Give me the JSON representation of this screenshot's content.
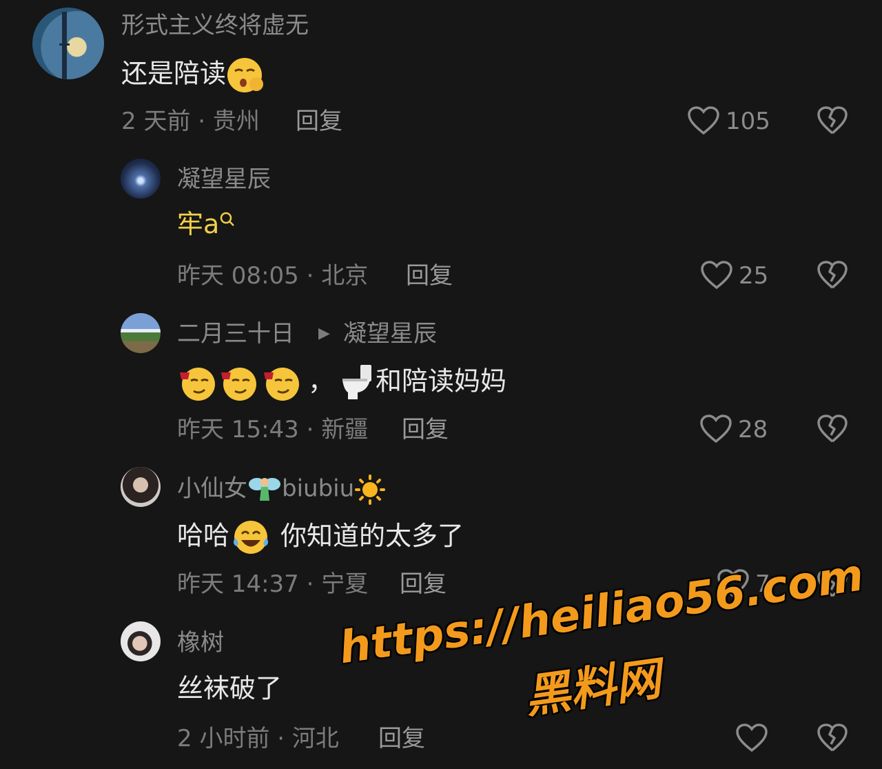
{
  "comments": [
    {
      "username": "形式主义终将虚无",
      "text": "还是陪读",
      "emoji": "shushing-face",
      "meta": "2 天前 · 贵州",
      "reply_label": "回复",
      "likes": "105"
    },
    {
      "username": "凝望星辰",
      "text": "牢a",
      "meta": "昨天 08:05 · 北京",
      "reply_label": "回复",
      "likes": "25"
    },
    {
      "username": "二月三十日",
      "reply_to": "凝望星辰",
      "text_prefix": "，",
      "text": "和陪读妈妈",
      "emojis": [
        "smirk-wine-face",
        "smirk-wine-face",
        "smirk-wine-face",
        "toilet"
      ],
      "meta": "昨天 15:43 · 新疆",
      "reply_label": "回复",
      "likes": "28"
    },
    {
      "username_a": "小仙女",
      "username_b": "biubiu",
      "username_emojis": [
        "fairy",
        "sun"
      ],
      "text_a": "哈哈",
      "text_b": "你知道的太多了",
      "emoji": "tears-of-joy",
      "meta": "昨天 14:37 · 宁夏",
      "reply_label": "回复",
      "likes": "7"
    },
    {
      "username": "橡树",
      "text": "丝袜破了",
      "meta": "2 小时前 · 河北",
      "reply_label": "回复",
      "likes": ""
    }
  ],
  "watermark": {
    "line1": "https://heiliao56.com",
    "line2": "黑料网"
  },
  "colors": {
    "background": "#161616",
    "username": "#8a8a8a",
    "text": "#e8e8e8",
    "gold_text": "#f2cf49",
    "watermark": "#f39a1c"
  }
}
